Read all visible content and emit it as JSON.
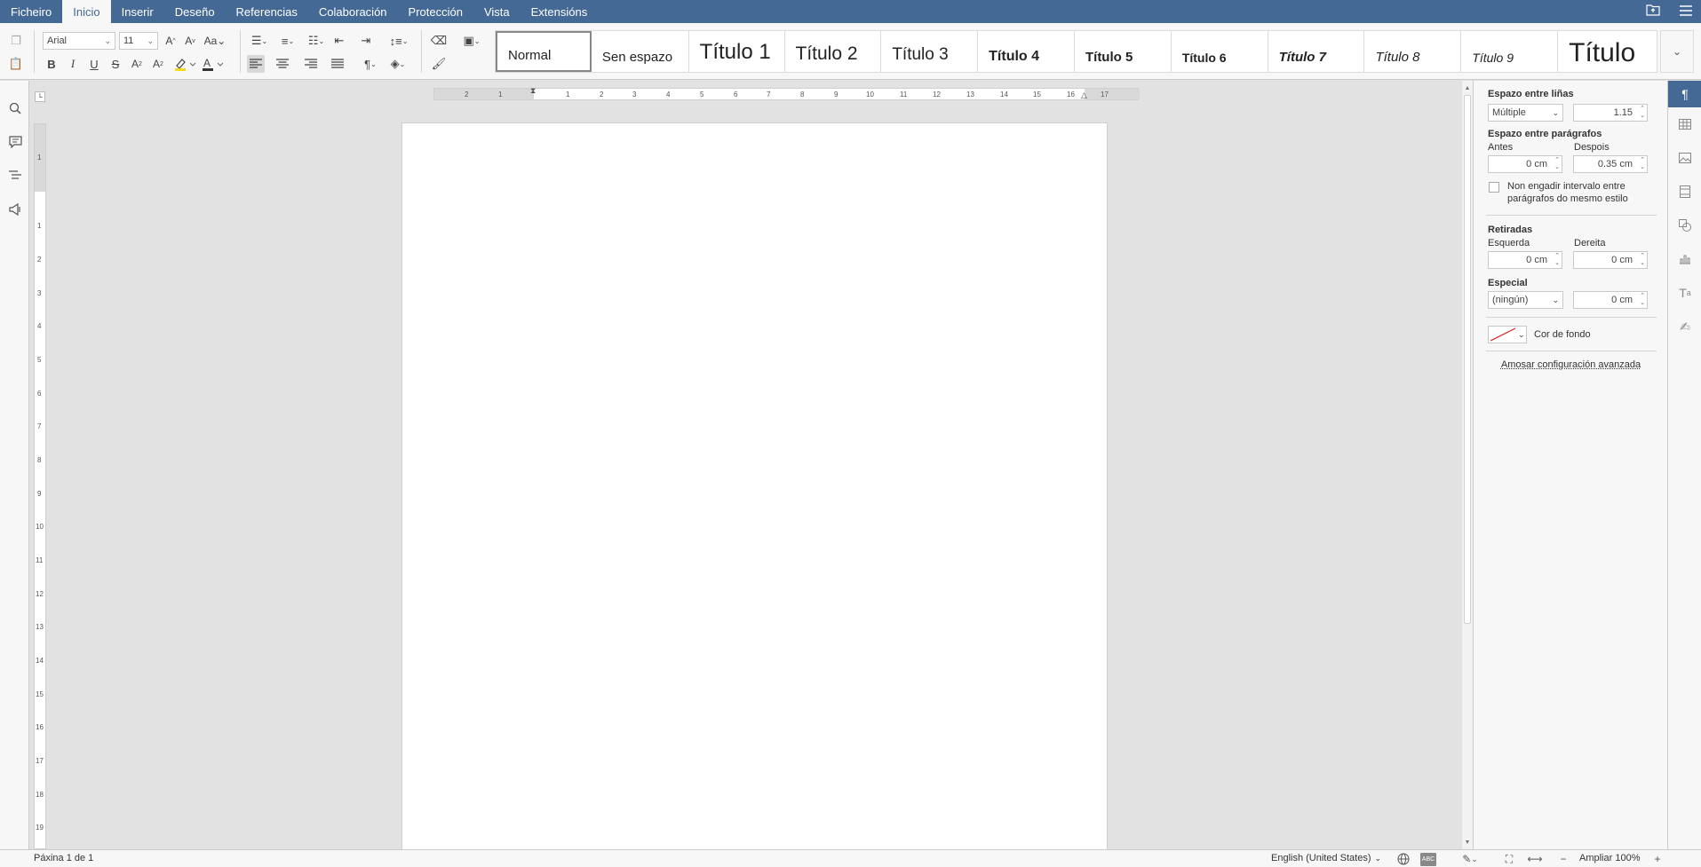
{
  "menu": {
    "tabs": [
      "Ficheiro",
      "Inicio",
      "Inserir",
      "Deseño",
      "Referencias",
      "Colaboración",
      "Protección",
      "Vista",
      "Extensións"
    ],
    "active_index": 1
  },
  "toolbar": {
    "font_name": "Arial",
    "font_size": "11"
  },
  "styles": {
    "items": [
      "Normal",
      "Sen espazo",
      "Título 1",
      "Título 2",
      "Título 3",
      "Título 4",
      "Título 5",
      "Título 6",
      "Título 7",
      "Título 8",
      "Título 9",
      "Título"
    ]
  },
  "ruler": {
    "h_left": [
      "2",
      "1"
    ],
    "h_right": [
      "1",
      "2",
      "3",
      "4",
      "5",
      "6",
      "7",
      "8",
      "9",
      "10",
      "11",
      "12",
      "13",
      "14",
      "15",
      "16",
      "17"
    ],
    "v_top": [
      "1"
    ],
    "v_main": [
      "1",
      "2",
      "3",
      "4",
      "5",
      "6",
      "7",
      "8",
      "9",
      "10",
      "11",
      "12",
      "13",
      "14",
      "15",
      "16",
      "17",
      "18",
      "19"
    ]
  },
  "panel": {
    "line_spacing_title": "Espazo entre liñas",
    "line_spacing_mode": "Múltiple",
    "line_spacing_value": "1.15",
    "para_spacing_title": "Espazo entre parágrafos",
    "before_label": "Antes",
    "before_value": "0 cm",
    "after_label": "Despois",
    "after_value": "0.35 cm",
    "no_interval_line1": "Non engadir intervalo entre",
    "no_interval_line2": "parágrafos do mesmo estilo",
    "indents_title": "Retiradas",
    "left_label": "Esquerda",
    "left_value": "0 cm",
    "right_label": "Dereita",
    "right_value": "0 cm",
    "special_label": "Especial",
    "special_mode": "(ningún)",
    "special_value": "0 cm",
    "bg_color_label": "Cor de fondo",
    "advanced_link": "Amosar configuración avanzada"
  },
  "status": {
    "page_info": "Páxina 1 de 1",
    "language": "English (United States)",
    "zoom": "Ampliar 100%"
  }
}
